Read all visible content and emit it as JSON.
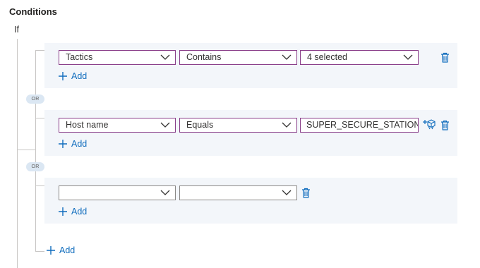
{
  "header": {
    "title": "Conditions",
    "if_label": "If"
  },
  "or_label": "OR",
  "groups": [
    {
      "property": "Tactics",
      "operator": "Contains",
      "value": "4 selected",
      "add_label": "Add"
    },
    {
      "property": "Host name",
      "operator": "Equals",
      "value": "SUPER_SECURE_STATION",
      "add_label": "Add"
    },
    {
      "property": "",
      "operator": "",
      "add_label": "Add"
    }
  ],
  "footer": {
    "add_label": "Add"
  },
  "colors": {
    "accent": "#0f6cbd",
    "field_border_active": "#8a3f8a",
    "group_background": "#f3f6fa",
    "or_pill": "#dbe7f3"
  },
  "icons": [
    "chevron-down-icon",
    "plus-icon",
    "trash-icon",
    "entity-mapping-icon"
  ]
}
